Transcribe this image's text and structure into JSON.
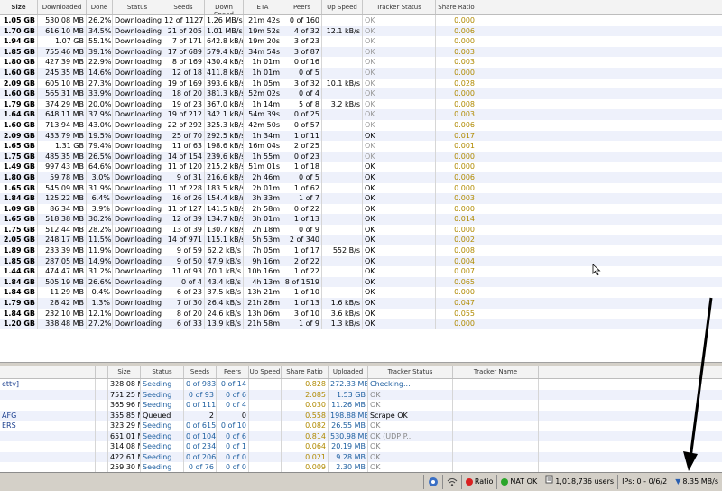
{
  "top_table": {
    "headers": [
      "Size",
      "Downloaded",
      "Done",
      "Status",
      "Seeds",
      "Down Speed",
      "ETA",
      "Peers",
      "Up Speed",
      "Tracker Status",
      "Share Ratio"
    ],
    "rows": [
      [
        "1.05 GB",
        "530.08 MB",
        "26.2%",
        "Downloading",
        "12 of 1127",
        "1.26 MB/s",
        "21m 42s",
        "0 of 160",
        "",
        "OK",
        "0.000"
      ],
      [
        "1.70 GB",
        "616.10 MB",
        "34.5%",
        "Downloading",
        "21 of 205",
        "1.01 MB/s",
        "19m 52s",
        "4 of 32",
        "12.1 kB/s",
        "OK",
        "0.006"
      ],
      [
        "1.94 GB",
        "1.07 GB",
        "55.1%",
        "Downloading",
        "7 of 171",
        "642.8 kB/s",
        "19m 20s",
        "3 of 23",
        "",
        "OK",
        "0.000"
      ],
      [
        "1.85 GB",
        "755.46 MB",
        "39.1%",
        "Downloading",
        "17 of 689",
        "579.4 kB/s",
        "34m 54s",
        "3 of 87",
        "",
        "OK",
        "0.003"
      ],
      [
        "1.80 GB",
        "427.39 MB",
        "22.9%",
        "Downloading",
        "8 of 169",
        "430.4 kB/s",
        "1h 01m",
        "0 of 16",
        "",
        "OK",
        "0.003"
      ],
      [
        "1.60 GB",
        "245.35 MB",
        "14.6%",
        "Downloading",
        "12 of 18",
        "411.8 kB/s",
        "1h 01m",
        "0 of 5",
        "",
        "OK",
        "0.000"
      ],
      [
        "2.09 GB",
        "605.10 MB",
        "27.3%",
        "Downloading",
        "19 of 169",
        "393.6 kB/s",
        "1h 05m",
        "3 of 32",
        "10.1 kB/s",
        "OK",
        "0.028"
      ],
      [
        "1.60 GB",
        "565.31 MB",
        "33.9%",
        "Downloading",
        "18 of 20",
        "381.3 kB/s",
        "52m 02s",
        "0 of 4",
        "",
        "OK",
        "0.000"
      ],
      [
        "1.79 GB",
        "374.29 MB",
        "20.0%",
        "Downloading",
        "19 of 23",
        "367.0 kB/s",
        "1h 14m",
        "5 of 8",
        "3.2 kB/s",
        "OK",
        "0.008"
      ],
      [
        "1.64 GB",
        "648.11 MB",
        "37.9%",
        "Downloading",
        "19 of 212",
        "342.1 kB/s",
        "54m 39s",
        "0 of 25",
        "",
        "OK",
        "0.003"
      ],
      [
        "1.60 GB",
        "713.94 MB",
        "43.0%",
        "Downloading",
        "22 of 292",
        "325.3 kB/s",
        "42m 50s",
        "0 of 57",
        "",
        "OK",
        "0.006"
      ],
      [
        "2.09 GB",
        "433.79 MB",
        "19.5%",
        "Downloading",
        "25 of 70",
        "292.5 kB/s",
        "1h 34m",
        "1 of 11",
        "",
        "OK",
        "0.017"
      ],
      [
        "1.65 GB",
        "1.31 GB",
        "79.4%",
        "Downloading",
        "11 of 63",
        "198.6 kB/s",
        "16m 04s",
        "2 of 25",
        "",
        "OK",
        "0.001"
      ],
      [
        "1.75 GB",
        "485.35 MB",
        "26.5%",
        "Downloading",
        "14 of 154",
        "239.6 kB/s",
        "1h 55m",
        "0 of 23",
        "",
        "OK",
        "0.000"
      ],
      [
        "1.49 GB",
        "997.43 MB",
        "64.6%",
        "Downloading",
        "11 of 120",
        "215.2 kB/s",
        "51m 01s",
        "1 of 18",
        "",
        "OK",
        "0.000"
      ],
      [
        "1.80 GB",
        "59.78 MB",
        "3.0%",
        "Downloading",
        "9 of 31",
        "216.6 kB/s",
        "2h 46m",
        "0 of 5",
        "",
        "OK",
        "0.006"
      ],
      [
        "1.65 GB",
        "545.09 MB",
        "31.9%",
        "Downloading",
        "11 of 228",
        "183.5 kB/s",
        "2h 01m",
        "1 of 62",
        "",
        "OK",
        "0.000"
      ],
      [
        "1.84 GB",
        "125.22 MB",
        "6.4%",
        "Downloading",
        "16 of 26",
        "154.4 kB/s",
        "3h 33m",
        "1 of 7",
        "",
        "OK",
        "0.003"
      ],
      [
        "1.09 GB",
        "86.34 MB",
        "3.9%",
        "Downloading",
        "11 of 127",
        "141.5 kB/s",
        "2h 58m",
        "0 of 22",
        "",
        "OK",
        "0.000"
      ],
      [
        "1.65 GB",
        "518.38 MB",
        "30.2%",
        "Downloading",
        "12 of 39",
        "134.7 kB/s",
        "3h 01m",
        "1 of 13",
        "",
        "OK",
        "0.014"
      ],
      [
        "1.75 GB",
        "512.44 MB",
        "28.2%",
        "Downloading",
        "13 of 39",
        "130.7 kB/s",
        "2h 18m",
        "0 of 9",
        "",
        "OK",
        "0.000"
      ],
      [
        "2.05 GB",
        "248.17 MB",
        "11.5%",
        "Downloading",
        "14 of 971",
        "115.1 kB/s",
        "5h 53m",
        "2 of 340",
        "",
        "OK",
        "0.002"
      ],
      [
        "1.89 GB",
        "233.39 MB",
        "11.9%",
        "Downloading",
        "9 of 59",
        "62.2 kB/s",
        "7h 05m",
        "1 of 17",
        "552 B/s",
        "OK",
        "0.008"
      ],
      [
        "1.85 GB",
        "287.05 MB",
        "14.9%",
        "Downloading",
        "9 of 50",
        "47.9 kB/s",
        "9h 16m",
        "2 of 22",
        "",
        "OK",
        "0.004"
      ],
      [
        "1.44 GB",
        "474.47 MB",
        "31.2%",
        "Downloading",
        "11 of 93",
        "70.1 kB/s",
        "10h 16m",
        "1 of 22",
        "",
        "OK",
        "0.007"
      ],
      [
        "1.84 GB",
        "505.19 MB",
        "26.6%",
        "Downloading",
        "0 of 4",
        "43.4 kB/s",
        "4h 13m",
        "8 of 1519",
        "",
        "OK",
        "0.065"
      ],
      [
        "1.84 GB",
        "11.29 MB",
        "0.4%",
        "Downloading",
        "6 of 23",
        "37.5 kB/s",
        "13h 21m",
        "1 of 10",
        "",
        "OK",
        "0.000"
      ],
      [
        "1.79 GB",
        "28.42 MB",
        "1.3%",
        "Downloading",
        "7 of 30",
        "26.4 kB/s",
        "21h 28m",
        "1 of 13",
        "1.6 kB/s",
        "OK",
        "0.047"
      ],
      [
        "1.84 GB",
        "232.10 MB",
        "12.1%",
        "Downloading",
        "8 of 20",
        "24.6 kB/s",
        "13h 06m",
        "3 of 10",
        "3.6 kB/s",
        "OK",
        "0.055"
      ],
      [
        "1.20 GB",
        "338.48 MB",
        "27.2%",
        "Downloading",
        "6 of 33",
        "13.9 kB/s",
        "21h 58m",
        "1 of 9",
        "1.3 kB/s",
        "OK",
        "0.000"
      ]
    ]
  },
  "bottom_table": {
    "headers": [
      "",
      "",
      "Size",
      "Status",
      "Seeds",
      "Peers",
      "Up Speed",
      "Share Ratio",
      "Uploaded",
      "Tracker Status",
      "Tracker Name"
    ],
    "rows": [
      [
        "ettv]",
        "",
        "328.08 MB",
        "Seeding",
        "0 of 983",
        "0 of 14",
        "",
        "0.828",
        "272.33 MB",
        "Checking...",
        ""
      ],
      [
        "",
        "",
        "751.25 MB",
        "Seeding",
        "0 of 93",
        "0 of 6",
        "",
        "2.085",
        "1.53 GB",
        "OK",
        ""
      ],
      [
        "",
        "",
        "365.96 MB",
        "Seeding",
        "0 of 111",
        "0 of 4",
        "",
        "0.030",
        "11.26 MB",
        "OK",
        ""
      ],
      [
        "AFG",
        "",
        "355.85 MB",
        "Queued",
        "2",
        "0",
        "",
        "0.558",
        "198.88 MB",
        "Scrape OK",
        ""
      ],
      [
        "ERS",
        "",
        "323.29 MB",
        "Seeding",
        "0 of 615",
        "0 of 10",
        "",
        "0.082",
        "26.55 MB",
        "OK",
        ""
      ],
      [
        "",
        "",
        "651.01 MB",
        "Seeding",
        "0 of 104",
        "0 of 6",
        "",
        "0.814",
        "530.98 MB",
        "OK (UDP P...",
        ""
      ],
      [
        "",
        "",
        "314.08 MB",
        "Seeding",
        "0 of 234",
        "0 of 1",
        "",
        "0.064",
        "20.19 MB",
        "OK",
        ""
      ],
      [
        "",
        "",
        "422.61 MB",
        "Seeding",
        "0 of 206",
        "0 of 0",
        "",
        "0.021",
        "9.28 MB",
        "OK",
        ""
      ],
      [
        "",
        "",
        "259.30 MB",
        "Seeding",
        "0 of 76",
        "0 of 0",
        "",
        "0.009",
        "2.30 MB",
        "OK",
        ""
      ]
    ]
  },
  "status_bar": {
    "ratio_label": "Ratio",
    "nat_label": "NAT OK",
    "users": "1,018,736 users",
    "ips": "IPs: 0 - 0/6/2",
    "down_speed": "8.35 MB/s",
    "colors": {
      "ratio_dot": "#d92020",
      "nat_dot": "#2aa52a"
    }
  }
}
